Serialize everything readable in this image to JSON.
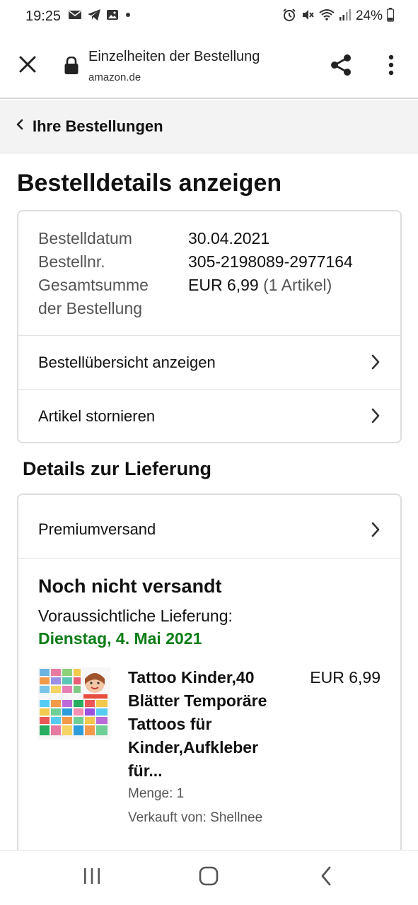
{
  "status_bar": {
    "time": "19:25",
    "battery_percent": "24%",
    "left_icons": [
      "mail-icon",
      "telegram-icon",
      "gallery-icon",
      "notification-dot-icon"
    ],
    "right_icons": [
      "alarm-icon",
      "mute-icon",
      "wifi-icon",
      "signal-icon",
      "battery-icon"
    ]
  },
  "browser": {
    "title": "Einzelheiten der Bestellung",
    "domain": "amazon.de"
  },
  "breadcrumb": {
    "label": "Ihre Bestellungen"
  },
  "page_title": "Bestelldetails anzeigen",
  "order": {
    "date_label": "Bestelldatum",
    "date_value": "30.04.2021",
    "number_label": "Bestellnr.",
    "number_value": "305-2198089-2977164",
    "total_label_line1": "Gesamtsumme",
    "total_label_line2": "der Bestellung",
    "total_value": "EUR 6,99",
    "total_items": "(1 Artikel)",
    "summary_link": "Bestellübersicht anzeigen",
    "cancel_link": "Artikel stornieren"
  },
  "delivery": {
    "heading": "Details zur Lieferung",
    "shipping_method": "Premiumversand",
    "status": "Noch nicht versandt",
    "eta_label": "Voraussichtliche Lieferung:",
    "eta_date": "Dienstag, 4. Mai 2021",
    "eta_color": "#0c7d16"
  },
  "product": {
    "title_line1": "Tattoo Kinder,40",
    "title_line2": "Blätter Temporäre",
    "title_line3": "Tattoos für",
    "title_line4": "Kinder,Aufkleber",
    "title_line5": "für...",
    "price": "EUR 6,99",
    "quantity": "Menge: 1",
    "seller": "Verkauft von: Shellnee"
  },
  "nav": {
    "icons": [
      "recent-apps-icon",
      "home-icon",
      "back-icon"
    ]
  }
}
